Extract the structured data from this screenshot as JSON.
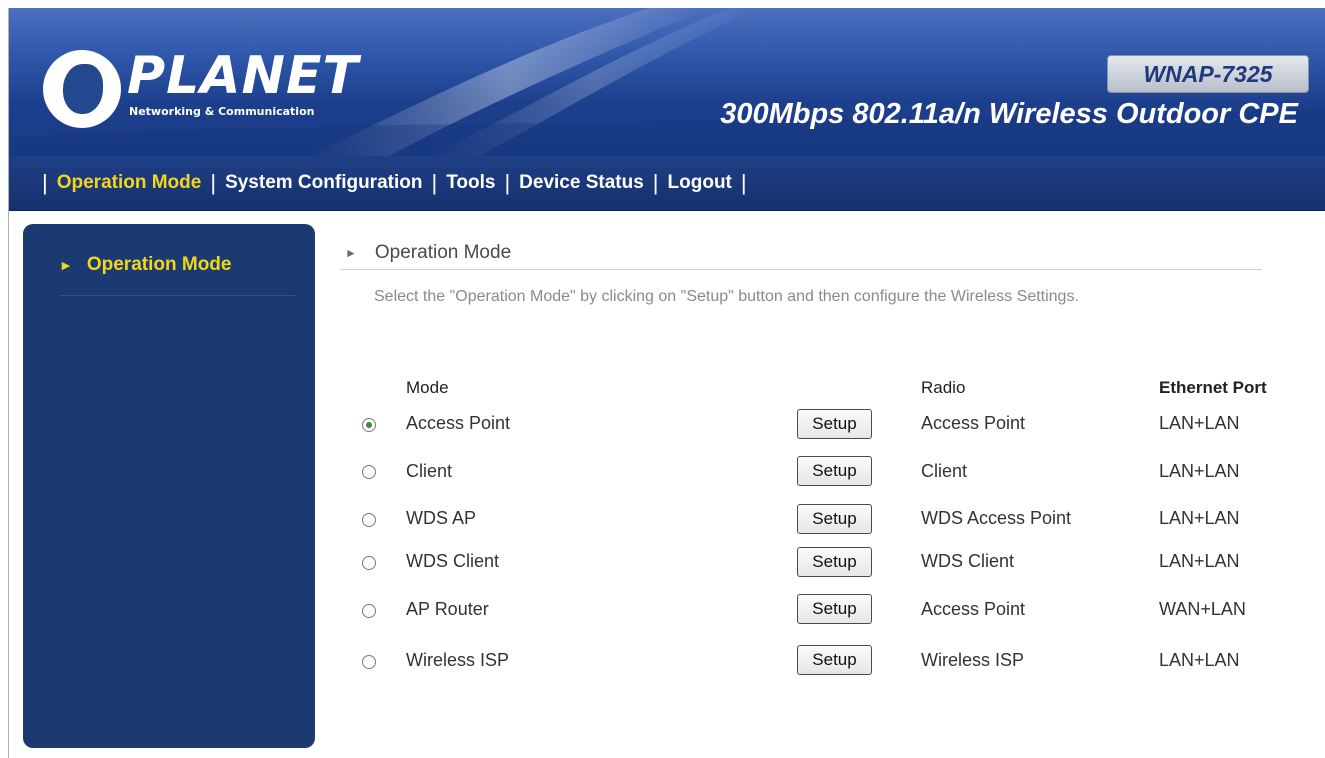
{
  "header": {
    "logo_text": "PLANET",
    "logo_subtitle": "Networking & Communication",
    "model": "WNAP-7325",
    "product_title": "300Mbps 802.11a/n Wireless Outdoor CPE"
  },
  "nav": {
    "items": [
      {
        "label": "Operation Mode",
        "active": true
      },
      {
        "label": "System Configuration",
        "active": false
      },
      {
        "label": "Tools",
        "active": false
      },
      {
        "label": "Device Status",
        "active": false
      },
      {
        "label": "Logout",
        "active": false
      }
    ],
    "separator": "|"
  },
  "sidebar": {
    "items": [
      {
        "label": "Operation Mode",
        "icon": "triangle-right-icon"
      }
    ]
  },
  "main": {
    "section_title": "Operation Mode",
    "description": "Select the \"Operation Mode\" by clicking on \"Setup\" button and then configure the Wireless Settings.",
    "columns": {
      "mode": "Mode",
      "radio": "Radio",
      "ethernet": "Ethernet Port"
    },
    "setup_label": "Setup",
    "rows": [
      {
        "mode": "Access Point",
        "radio": "Access Point",
        "ethernet": "LAN+LAN",
        "selected": true
      },
      {
        "mode": "Client",
        "radio": "Client",
        "ethernet": "LAN+LAN",
        "selected": false
      },
      {
        "mode": "WDS AP",
        "radio": "WDS Access Point",
        "ethernet": "LAN+LAN",
        "selected": false
      },
      {
        "mode": "WDS Client",
        "radio": "WDS Client",
        "ethernet": "LAN+LAN",
        "selected": false
      },
      {
        "mode": "AP Router",
        "radio": "Access Point",
        "ethernet": "WAN+LAN",
        "selected": false
      },
      {
        "mode": "Wireless ISP",
        "radio": "Wireless ISP",
        "ethernet": "LAN+LAN",
        "selected": false
      }
    ]
  },
  "colors": {
    "header_blue": "#1c3f8c",
    "nav_active": "#f3d51b",
    "sidebar_bg": "#1b3a72"
  }
}
